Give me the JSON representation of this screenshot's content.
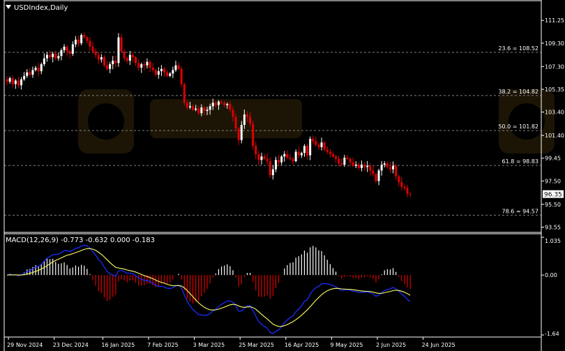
{
  "header": {
    "symbol_label": "USDIndex,Daily"
  },
  "macd": {
    "label": "MACD(12,26,9) -0.773 -0.632 0.000 -0.183",
    "axis_labels": [
      "1.035",
      "0.00",
      "-1.64"
    ]
  },
  "current_price": "96.35",
  "colors": {
    "background": "#000000",
    "bull": "#ffffff",
    "bear": "#e00000",
    "macd_hist_pos": "#ffffff",
    "macd_hist_neg": "#e00000",
    "macd_line": "#1a2cff",
    "signal_line": "#ffff66",
    "fib_line": "#808080",
    "axis_text": "#ffffff"
  },
  "chart_data": [
    {
      "type": "candlestick",
      "title": "USDIndex,Daily",
      "y_ticks": [
        93.55,
        95.5,
        97.5,
        99.45,
        101.4,
        103.4,
        105.35,
        107.3,
        109.3,
        111.25
      ],
      "ylim": [
        93.4,
        112.4
      ],
      "x_ticks": [
        "29 Nov 2024",
        "23 Dec 2024",
        "16 Jan 2025",
        "7 Feb 2025",
        "3 Mar 2025",
        "25 Mar 2025",
        "16 Apr 2025",
        "9 May 2025",
        "2 Jun 2025",
        "24 Jun 2025"
      ],
      "x_tick_bar_index": [
        1,
        17,
        34,
        50,
        66,
        82,
        98,
        114,
        130,
        146
      ],
      "fib_levels": [
        {
          "label": "23.6 = 108.52",
          "value": 108.52
        },
        {
          "label": "38.2 = 104.82",
          "value": 104.82
        },
        {
          "label": "50.0 = 101.82",
          "value": 101.82
        },
        {
          "label": "61.8 = 98.83",
          "value": 98.83
        },
        {
          "label": "78.6 = 94.57",
          "value": 94.57
        }
      ],
      "closes": [
        106.0,
        106.3,
        105.8,
        106.1,
        105.7,
        106.2,
        106.5,
        106.8,
        106.6,
        107.0,
        107.2,
        106.9,
        107.5,
        108.0,
        108.3,
        108.1,
        108.4,
        108.0,
        108.2,
        108.7,
        109.0,
        108.6,
        108.4,
        109.2,
        109.6,
        109.3,
        110.0,
        109.8,
        109.5,
        109.0,
        108.6,
        108.3,
        107.9,
        108.1,
        107.4,
        107.1,
        107.5,
        107.8,
        107.6,
        109.8,
        108.6,
        108.0,
        107.8,
        108.3,
        108.1,
        107.6,
        107.2,
        107.5,
        107.4,
        107.7,
        107.2,
        107.0,
        106.6,
        106.9,
        107.1,
        106.8,
        106.5,
        106.7,
        107.0,
        107.4,
        107.1,
        105.8,
        104.2,
        103.8,
        103.9,
        103.6,
        103.7,
        103.3,
        103.8,
        103.5,
        103.6,
        103.9,
        104.2,
        104.0,
        104.3,
        104.2,
        104.0,
        104.1,
        103.6,
        103.0,
        102.0,
        101.0,
        102.3,
        103.2,
        103.0,
        102.4,
        100.5,
        99.8,
        99.3,
        99.6,
        99.4,
        99.2,
        98.0,
        98.5,
        99.3,
        99.1,
        99.6,
        99.8,
        99.5,
        99.4,
        99.2,
        100.0,
        99.7,
        99.9,
        100.5,
        99.7,
        101.1,
        100.9,
        100.6,
        100.4,
        100.8,
        100.2,
        100.0,
        99.8,
        99.6,
        99.4,
        99.0,
        98.9,
        99.5,
        99.4,
        99.1,
        98.8,
        98.9,
        98.6,
        98.9,
        98.7,
        98.8,
        98.4,
        98.1,
        97.5,
        98.4,
        98.9,
        99.0,
        98.7,
        98.5,
        98.8,
        97.9,
        97.4,
        97.0,
        96.9,
        96.4,
        96.35
      ]
    },
    {
      "type": "macd",
      "title": "MACD(12,26,9) -0.773 -0.632 0.000 -0.183",
      "params": [
        12,
        26,
        9
      ],
      "values": {
        "macd": -0.773,
        "signal": -0.632,
        "zero": 0.0,
        "histogram": -0.183
      },
      "ylim": [
        -1.64,
        1.035
      ],
      "series": [
        {
          "name": "MACD",
          "type": "histogram"
        },
        {
          "name": "Main",
          "type": "line"
        },
        {
          "name": "Signal",
          "type": "line"
        }
      ]
    }
  ]
}
